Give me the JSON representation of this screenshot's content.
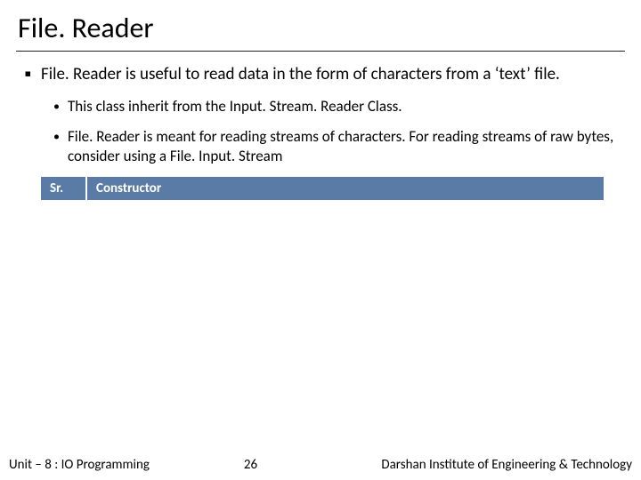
{
  "title": "File. Reader",
  "bullets": {
    "p1": "File. Reader is useful to read data in the form of characters from a ‘text’ file.",
    "p2": "This class inherit from the Input. Stream. Reader Class.",
    "p3": "File. Reader is meant for reading streams of characters. For reading streams of raw bytes, consider using a File. Input. Stream"
  },
  "table": {
    "header_sr": "Sr.",
    "header_constructor": "Constructor"
  },
  "footer": {
    "unit": "Unit – 8 : IO Programming",
    "page": "26",
    "institute": "Darshan Institute of Engineering & Technology"
  }
}
